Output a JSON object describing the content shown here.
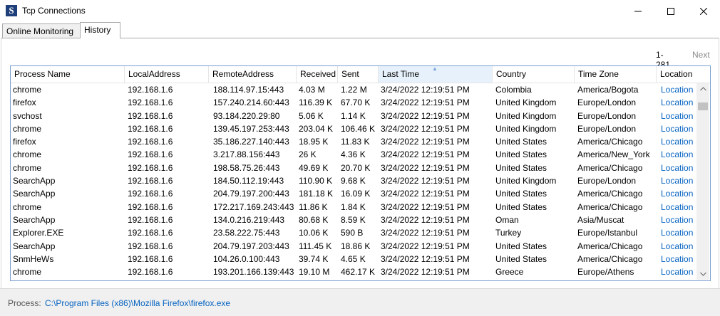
{
  "window": {
    "title": "Tcp Connections",
    "icon_letter": "S"
  },
  "tabs": [
    {
      "label": "Online Monitoring"
    },
    {
      "label": "History"
    }
  ],
  "pager": {
    "range": "1-281",
    "next": "Next"
  },
  "grid": {
    "columns": [
      "Process Name",
      "LocalAddress",
      "RemoteAddress",
      "Received",
      "Sent",
      "Last Time",
      "Country",
      "Time Zone",
      "Location"
    ],
    "sorted_column": "Last Time",
    "rows": [
      [
        "chrome",
        "192.168.1.6",
        "188.114.97.15:443",
        "4.03 M",
        "1.22 M",
        "3/24/2022 12:19:51 PM",
        "Colombia",
        "America/Bogota",
        "Location"
      ],
      [
        "firefox",
        "192.168.1.6",
        "157.240.214.60:443",
        "116.39 K",
        "67.70 K",
        "3/24/2022 12:19:51 PM",
        "United Kingdom",
        "Europe/London",
        "Location"
      ],
      [
        "svchost",
        "192.168.1.6",
        "93.184.220.29:80",
        "5.06 K",
        "1.14 K",
        "3/24/2022 12:19:51 PM",
        "United Kingdom",
        "Europe/London",
        "Location"
      ],
      [
        "chrome",
        "192.168.1.6",
        "139.45.197.253:443",
        "203.04 K",
        "106.46 K",
        "3/24/2022 12:19:51 PM",
        "United Kingdom",
        "Europe/London",
        "Location"
      ],
      [
        "firefox",
        "192.168.1.6",
        "35.186.227.140:443",
        "18.95 K",
        "11.83 K",
        "3/24/2022 12:19:51 PM",
        "United States",
        "America/Chicago",
        "Location"
      ],
      [
        "chrome",
        "192.168.1.6",
        "3.217.88.156:443",
        "26 K",
        "4.36 K",
        "3/24/2022 12:19:51 PM",
        "United States",
        "America/New_York",
        "Location"
      ],
      [
        "chrome",
        "192.168.1.6",
        "198.58.75.26:443",
        "49.69 K",
        "20.70 K",
        "3/24/2022 12:19:51 PM",
        "United States",
        "America/Chicago",
        "Location"
      ],
      [
        "SearchApp",
        "192.168.1.6",
        "184.50.112.19:443",
        "110.90 K",
        "9.68 K",
        "3/24/2022 12:19:51 PM",
        "United Kingdom",
        "Europe/London",
        "Location"
      ],
      [
        "SearchApp",
        "192.168.1.6",
        "204.79.197.200:443",
        "181.18 K",
        "16.09 K",
        "3/24/2022 12:19:51 PM",
        "United States",
        "America/Chicago",
        "Location"
      ],
      [
        "chrome",
        "192.168.1.6",
        "172.217.169.243:443",
        "11.86 K",
        "1.84 K",
        "3/24/2022 12:19:51 PM",
        "United States",
        "America/Chicago",
        "Location"
      ],
      [
        "SearchApp",
        "192.168.1.6",
        "134.0.216.219:443",
        "80.68 K",
        "8.59 K",
        "3/24/2022 12:19:51 PM",
        "Oman",
        "Asia/Muscat",
        "Location"
      ],
      [
        "Explorer.EXE",
        "192.168.1.6",
        "23.58.222.75:443",
        "10.06 K",
        "590 B",
        "3/24/2022 12:19:51 PM",
        "Turkey",
        "Europe/Istanbul",
        "Location"
      ],
      [
        "SearchApp",
        "192.168.1.6",
        "204.79.197.203:443",
        "111.45 K",
        "18.86 K",
        "3/24/2022 12:19:51 PM",
        "United States",
        "America/Chicago",
        "Location"
      ],
      [
        "SnmHeWs",
        "192.168.1.6",
        "104.26.0.100:443",
        "39.74 K",
        "4.65 K",
        "3/24/2022 12:19:51 PM",
        "United States",
        "America/Chicago",
        "Location"
      ],
      [
        "chrome",
        "192.168.1.6",
        "193.201.166.139:443",
        "19.10 M",
        "462.17 K",
        "3/24/2022 12:19:51 PM",
        "Greece",
        "Europe/Athens",
        "Location"
      ]
    ]
  },
  "footer": {
    "label": "Process:",
    "path": "C:\\Program Files (x86)\\Mozilla Firefox\\firefox.exe"
  },
  "colors": {
    "link": "#0563c1",
    "grid_border": "#7a9fce",
    "sorted_header": "#e7f1fb"
  }
}
